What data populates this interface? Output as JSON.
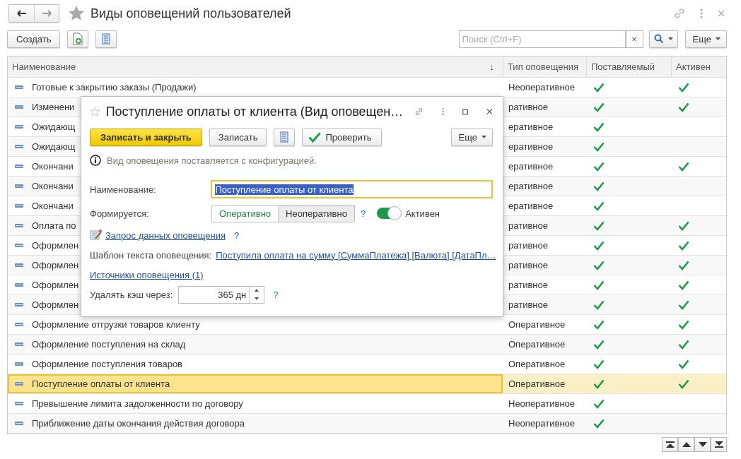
{
  "window": {
    "title": "Виды оповещений пользователей"
  },
  "toolbar": {
    "create": "Создать",
    "search": {
      "placeholder": "Поиск (Ctrl+F)",
      "clear": "×"
    },
    "more": "Еще"
  },
  "table": {
    "columns": [
      "Наименование",
      "Тип оповещения",
      "Поставляемый",
      "Активен"
    ],
    "sort_mark": "↓",
    "rows": [
      {
        "name": "Готовые к закрытию заказы (Продажи)",
        "type": "Неоперативное",
        "supplied": true,
        "active": true,
        "selected": false
      },
      {
        "name": "Изменени",
        "type": "ративное",
        "supplied": true,
        "active": true,
        "selected": false
      },
      {
        "name": "Ожидающ",
        "type": "еративное",
        "supplied": true,
        "active": false,
        "selected": false
      },
      {
        "name": "Ожидающ",
        "type": "еративное",
        "supplied": true,
        "active": false,
        "selected": false
      },
      {
        "name": "Окончани",
        "type": "еративное",
        "supplied": true,
        "active": true,
        "selected": false
      },
      {
        "name": "Окончани",
        "type": "еративное",
        "supplied": true,
        "active": false,
        "selected": false
      },
      {
        "name": "Окончани",
        "type": "еративное",
        "supplied": true,
        "active": false,
        "selected": false
      },
      {
        "name": "Оплата по",
        "type": "ративное",
        "supplied": true,
        "active": true,
        "selected": false
      },
      {
        "name": "Оформлен",
        "type": "ративное",
        "supplied": true,
        "active": true,
        "selected": false
      },
      {
        "name": "Оформлен",
        "type": "ративное",
        "supplied": true,
        "active": true,
        "selected": false
      },
      {
        "name": "Оформлен",
        "type": "ративное",
        "supplied": true,
        "active": true,
        "selected": false
      },
      {
        "name": "Оформлен",
        "type": "ративное",
        "supplied": true,
        "active": true,
        "selected": false
      },
      {
        "name": "Оформление отгрузки товаров клиенту",
        "type": "Оперативное",
        "supplied": true,
        "active": true,
        "selected": false
      },
      {
        "name": "Оформление поступления на склад",
        "type": "Оперативное",
        "supplied": true,
        "active": true,
        "selected": false
      },
      {
        "name": "Оформление поступления товаров",
        "type": "Оперативное",
        "supplied": true,
        "active": true,
        "selected": false
      },
      {
        "name": "Поступление оплаты от клиента",
        "type": "Оперативное",
        "supplied": true,
        "active": true,
        "selected": true
      },
      {
        "name": "Превышение лимита задолженности по договору",
        "type": "Неоперативное",
        "supplied": true,
        "active": false,
        "selected": false
      },
      {
        "name": "Приближение даты окончания действия договора",
        "type": "Неоперативное",
        "supplied": true,
        "active": false,
        "selected": false
      }
    ]
  },
  "dialog": {
    "title": "Поступление оплаты от клиента (Вид оповещен…",
    "save_close": "Записать и закрыть",
    "save": "Записать",
    "check": "Проверить",
    "more": "Еще",
    "info": "Вид оповещения поставляется с конфигурацией.",
    "name_label": "Наименование:",
    "name_value": "Поступление оплаты от клиента",
    "name_value_selected": true,
    "mode_label": "Формируется:",
    "modes": [
      {
        "label": "Оперативно",
        "selected": true
      },
      {
        "label": "Неоперативно",
        "selected": false
      }
    ],
    "mode_help": "?",
    "active": {
      "label": "Активен",
      "on": true
    },
    "query_link": "Запрос данных оповещения",
    "query_help": "?",
    "template_label": "Шаблон текста оповещения:",
    "template_link": "Поступила оплата на сумму [СуммаПлатежа] [Валюта] [ДатаПл…",
    "sources_link": "Источники оповещения (1)",
    "cache_label": "Удалять кэш через:",
    "cache_value": "365 дн",
    "cache_help": "?"
  }
}
